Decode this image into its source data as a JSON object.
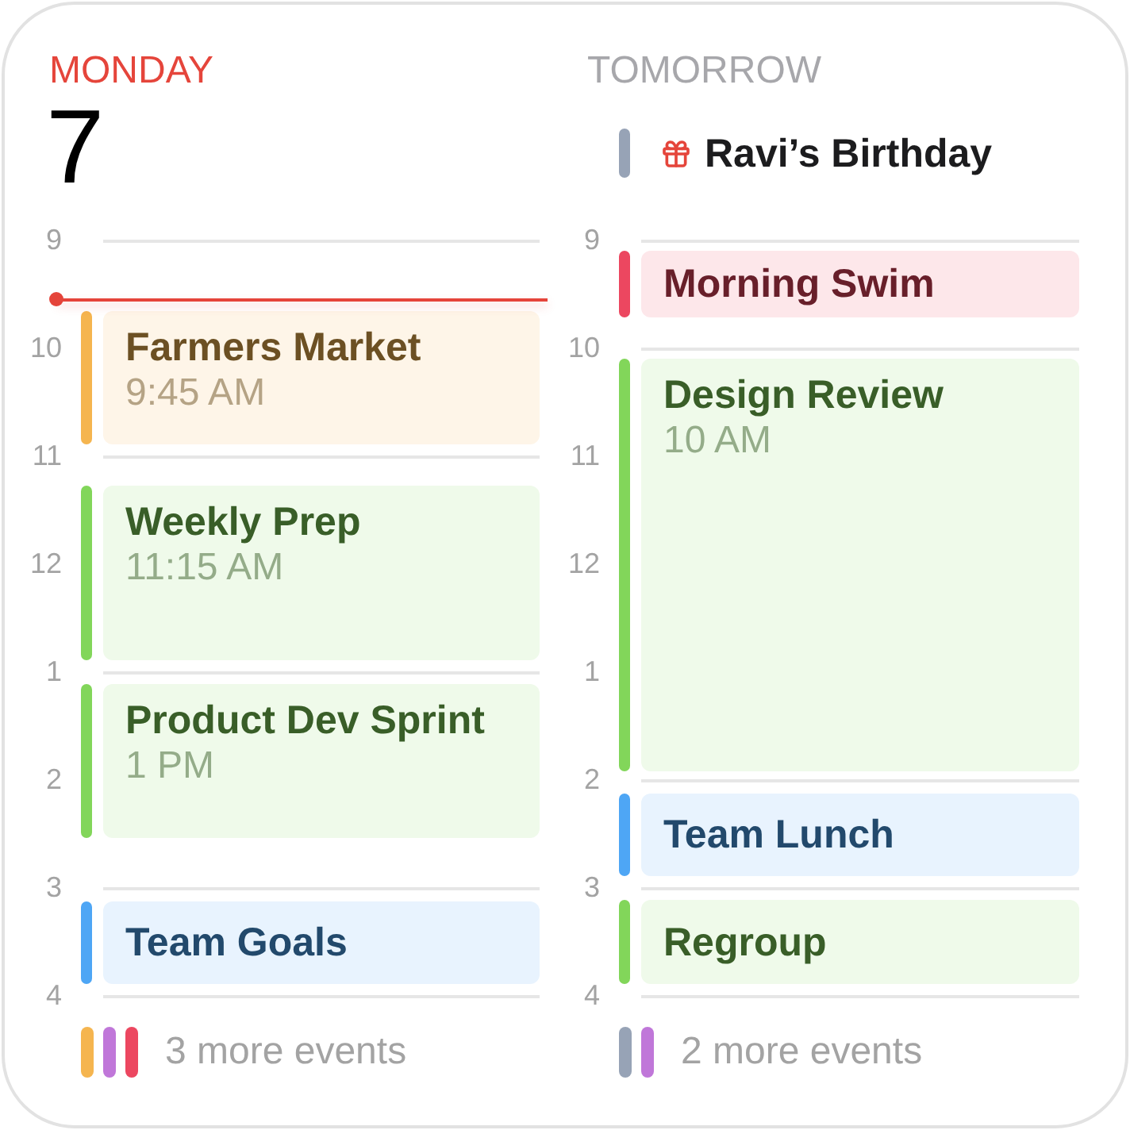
{
  "days": [
    {
      "name": "MONDAY",
      "today": true,
      "date": "7",
      "hours": [
        "9",
        "10",
        "11",
        "12",
        "1",
        "2",
        "3",
        "4"
      ],
      "events": [
        {
          "title": "Farmers Market",
          "time": "9:45 AM",
          "color": "#f5b54f"
        },
        {
          "title": "Weekly Prep",
          "time": "11:15 AM",
          "color": "#82d65a"
        },
        {
          "title": "Product Dev Sprint",
          "time": "1 PM",
          "color": "#82d65a"
        },
        {
          "title": "Team Goals",
          "color": "#4ea6f5"
        }
      ],
      "more_events": {
        "label": "3 more events",
        "markers": [
          {
            "color": "#f5b54f"
          },
          {
            "color": "#c077d9"
          },
          {
            "color": "#ec4760"
          }
        ]
      }
    },
    {
      "name": "TOMORROW",
      "today": false,
      "all_day": [
        {
          "title": "Ravi’s Birthday",
          "kind": "birthday",
          "color": "#97a3b6"
        }
      ],
      "hours": [
        "9",
        "10",
        "11",
        "12",
        "1",
        "2",
        "3",
        "4"
      ],
      "events": [
        {
          "title": "Morning Swim",
          "color": "#ec4760"
        },
        {
          "title": "Design Review",
          "time": "10 AM",
          "color": "#82d65a"
        },
        {
          "title": "Team Lunch",
          "color": "#4ea6f5"
        },
        {
          "title": "Regroup",
          "color": "#82d65a"
        }
      ],
      "more_events": {
        "label": "2 more events",
        "markers": [
          {
            "color": "#97a3b6"
          },
          {
            "color": "#c077d9"
          }
        ]
      }
    }
  ]
}
